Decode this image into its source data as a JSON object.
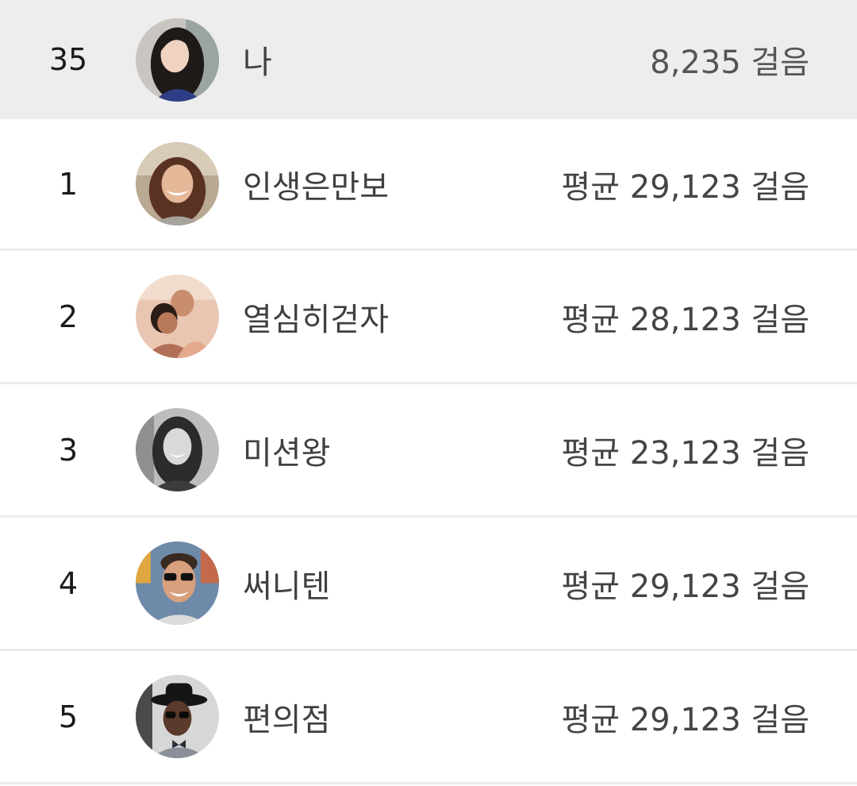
{
  "me": {
    "rank": "35",
    "name": "나",
    "steps": "8,235 걸음",
    "avatar_icon": "profile-photo-icon"
  },
  "ranking": [
    {
      "rank": "1",
      "name": "인생은만보",
      "steps": "평균 29,123 걸음",
      "avatar_icon": "profile-photo-icon"
    },
    {
      "rank": "2",
      "name": "열심히걷자",
      "steps": "평균 28,123 걸음",
      "avatar_icon": "profile-photo-icon"
    },
    {
      "rank": "3",
      "name": "미션왕",
      "steps": "평균 23,123 걸음",
      "avatar_icon": "profile-photo-icon"
    },
    {
      "rank": "4",
      "name": "써니텐",
      "steps": "평균 29,123 걸음",
      "avatar_icon": "profile-photo-icon"
    },
    {
      "rank": "5",
      "name": "편의점",
      "steps": "평균 29,123 걸음",
      "avatar_icon": "profile-photo-icon"
    }
  ],
  "colors": {
    "my_row_background": "#ededed",
    "row_background": "#ffffff",
    "divider": "#ececec",
    "rank_text": "#1a1a1a",
    "body_text": "#404040"
  }
}
